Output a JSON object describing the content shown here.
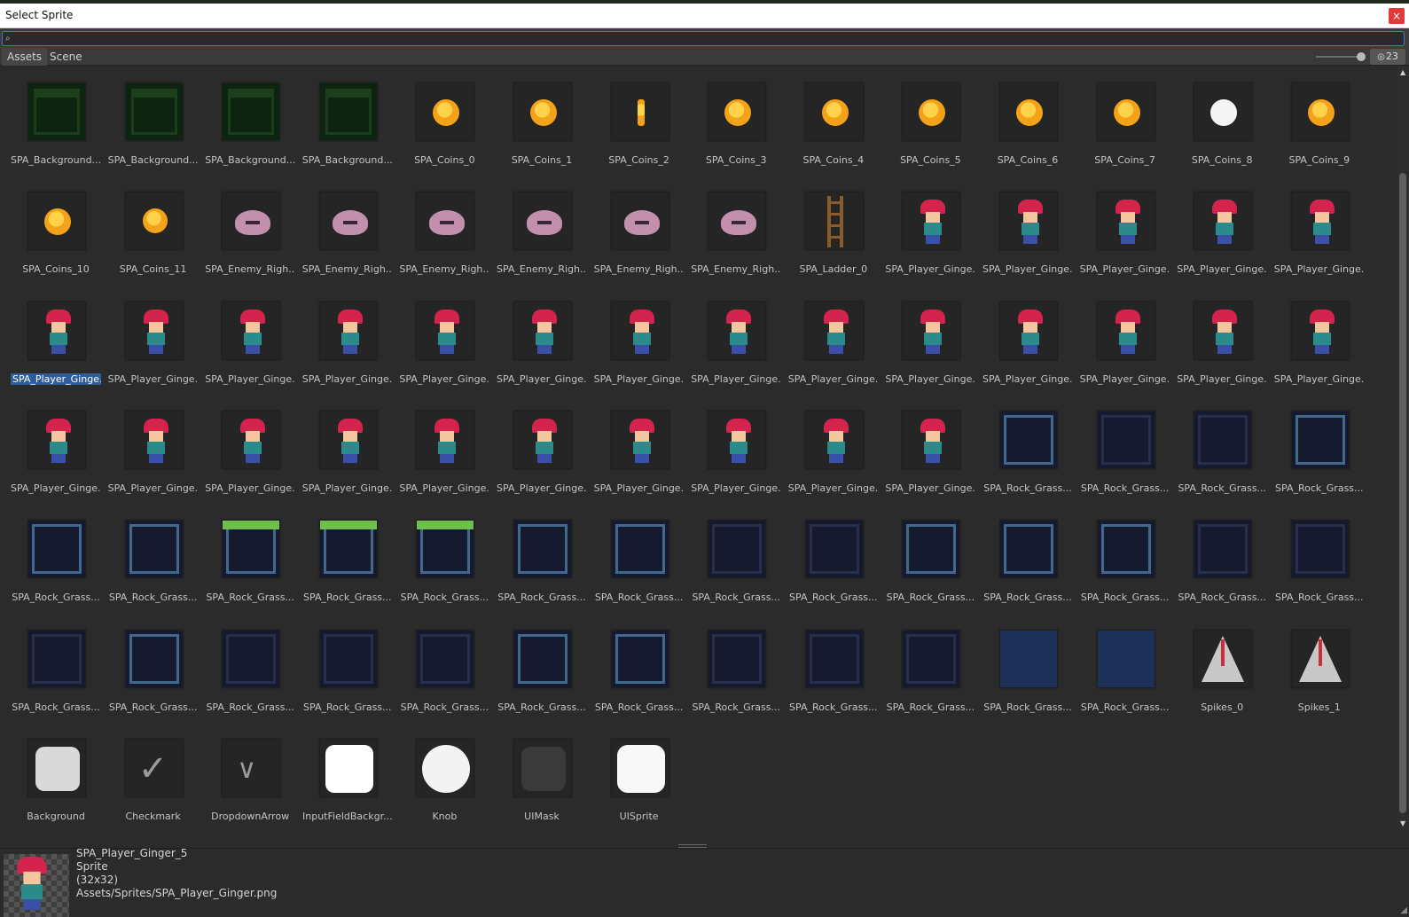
{
  "window": {
    "title": "Select Sprite",
    "close_glyph": "×"
  },
  "search": {
    "value": "",
    "placeholder": ""
  },
  "tabs": [
    {
      "label": "Assets",
      "active": true
    },
    {
      "label": "Scene",
      "active": false
    }
  ],
  "toolbar": {
    "hidden_count": "23"
  },
  "colors": {
    "selection": "#2f5d9a",
    "search_focus": "#3d7ad8",
    "close": "#e13a3a"
  },
  "items": [
    {
      "label": "SPA_Background...",
      "kind": "bg"
    },
    {
      "label": "SPA_Background...",
      "kind": "bg"
    },
    {
      "label": "SPA_Background...",
      "kind": "bg"
    },
    {
      "label": "SPA_Background...",
      "kind": "bg"
    },
    {
      "label": "SPA_Coins_0",
      "kind": "coin"
    },
    {
      "label": "SPA_Coins_1",
      "kind": "coin"
    },
    {
      "label": "SPA_Coins_2",
      "kind": "coin-thin"
    },
    {
      "label": "SPA_Coins_3",
      "kind": "coin"
    },
    {
      "label": "SPA_Coins_4",
      "kind": "coin"
    },
    {
      "label": "SPA_Coins_5",
      "kind": "coin"
    },
    {
      "label": "SPA_Coins_6",
      "kind": "coin"
    },
    {
      "label": "SPA_Coins_7",
      "kind": "coin"
    },
    {
      "label": "SPA_Coins_8",
      "kind": "coin-white"
    },
    {
      "label": "SPA_Coins_9",
      "kind": "coin"
    },
    {
      "label": "SPA_Coins_10",
      "kind": "coin"
    },
    {
      "label": "SPA_Coins_11",
      "kind": "coin-small"
    },
    {
      "label": "SPA_Enemy_Righ...",
      "kind": "enemy"
    },
    {
      "label": "SPA_Enemy_Righ...",
      "kind": "enemy"
    },
    {
      "label": "SPA_Enemy_Righ...",
      "kind": "enemy"
    },
    {
      "label": "SPA_Enemy_Righ...",
      "kind": "enemy"
    },
    {
      "label": "SPA_Enemy_Righ...",
      "kind": "enemy"
    },
    {
      "label": "SPA_Enemy_Righ...",
      "kind": "enemy"
    },
    {
      "label": "SPA_Ladder_0",
      "kind": "ladder"
    },
    {
      "label": "SPA_Player_Ginge...",
      "kind": "player"
    },
    {
      "label": "SPA_Player_Ginge...",
      "kind": "player"
    },
    {
      "label": "SPA_Player_Ginge...",
      "kind": "player"
    },
    {
      "label": "SPA_Player_Ginge...",
      "kind": "player"
    },
    {
      "label": "SPA_Player_Ginge...",
      "kind": "player"
    },
    {
      "label": "SPA_Player_Ginge...",
      "kind": "player",
      "selected": true
    },
    {
      "label": "SPA_Player_Ginge...",
      "kind": "player"
    },
    {
      "label": "SPA_Player_Ginge...",
      "kind": "player"
    },
    {
      "label": "SPA_Player_Ginge...",
      "kind": "player"
    },
    {
      "label": "SPA_Player_Ginge...",
      "kind": "player"
    },
    {
      "label": "SPA_Player_Ginge...",
      "kind": "player"
    },
    {
      "label": "SPA_Player_Ginge...",
      "kind": "player"
    },
    {
      "label": "SPA_Player_Ginge...",
      "kind": "player"
    },
    {
      "label": "SPA_Player_Ginge...",
      "kind": "player"
    },
    {
      "label": "SPA_Player_Ginge...",
      "kind": "player"
    },
    {
      "label": "SPA_Player_Ginge...",
      "kind": "player"
    },
    {
      "label": "SPA_Player_Ginge...",
      "kind": "player"
    },
    {
      "label": "SPA_Player_Ginge...",
      "kind": "player"
    },
    {
      "label": "SPA_Player_Ginge...",
      "kind": "player"
    },
    {
      "label": "SPA_Player_Ginge...",
      "kind": "player"
    },
    {
      "label": "SPA_Player_Ginge...",
      "kind": "player"
    },
    {
      "label": "SPA_Player_Ginge...",
      "kind": "player"
    },
    {
      "label": "SPA_Player_Ginge...",
      "kind": "player"
    },
    {
      "label": "SPA_Player_Ginge...",
      "kind": "player"
    },
    {
      "label": "SPA_Player_Ginge...",
      "kind": "player"
    },
    {
      "label": "SPA_Player_Ginge...",
      "kind": "player"
    },
    {
      "label": "SPA_Player_Ginge...",
      "kind": "player"
    },
    {
      "label": "SPA_Player_Ginge...",
      "kind": "player"
    },
    {
      "label": "SPA_Player_Ginge...",
      "kind": "player"
    },
    {
      "label": "SPA_Rock_Grass...",
      "kind": "rock"
    },
    {
      "label": "SPA_Rock_Grass...",
      "kind": "rock-dark"
    },
    {
      "label": "SPA_Rock_Grass...",
      "kind": "rock-dark"
    },
    {
      "label": "SPA_Rock_Grass...",
      "kind": "rock"
    },
    {
      "label": "SPA_Rock_Grass...",
      "kind": "rock"
    },
    {
      "label": "SPA_Rock_Grass...",
      "kind": "rock"
    },
    {
      "label": "SPA_Rock_Grass...",
      "kind": "rock-grass"
    },
    {
      "label": "SPA_Rock_Grass...",
      "kind": "rock-grass"
    },
    {
      "label": "SPA_Rock_Grass...",
      "kind": "rock-grass"
    },
    {
      "label": "SPA_Rock_Grass...",
      "kind": "rock"
    },
    {
      "label": "SPA_Rock_Grass...",
      "kind": "rock"
    },
    {
      "label": "SPA_Rock_Grass...",
      "kind": "rock-dark"
    },
    {
      "label": "SPA_Rock_Grass...",
      "kind": "rock-dark"
    },
    {
      "label": "SPA_Rock_Grass...",
      "kind": "rock"
    },
    {
      "label": "SPA_Rock_Grass...",
      "kind": "rock"
    },
    {
      "label": "SPA_Rock_Grass...",
      "kind": "rock"
    },
    {
      "label": "SPA_Rock_Grass...",
      "kind": "rock-dark"
    },
    {
      "label": "SPA_Rock_Grass...",
      "kind": "rock-dark"
    },
    {
      "label": "SPA_Rock_Grass...",
      "kind": "rock-dark"
    },
    {
      "label": "SPA_Rock_Grass...",
      "kind": "rock"
    },
    {
      "label": "SPA_Rock_Grass...",
      "kind": "rock-dark"
    },
    {
      "label": "SPA_Rock_Grass...",
      "kind": "rock-dark"
    },
    {
      "label": "SPA_Rock_Grass...",
      "kind": "rock-dark"
    },
    {
      "label": "SPA_Rock_Grass...",
      "kind": "rock"
    },
    {
      "label": "SPA_Rock_Grass...",
      "kind": "rock"
    },
    {
      "label": "SPA_Rock_Grass...",
      "kind": "rock-dark"
    },
    {
      "label": "SPA_Rock_Grass...",
      "kind": "rock-dark"
    },
    {
      "label": "SPA_Rock_Grass...",
      "kind": "rock-dark"
    },
    {
      "label": "SPA_Rock_Grass...",
      "kind": "rock-blue"
    },
    {
      "label": "SPA_Rock_Grass...",
      "kind": "rock-blue"
    },
    {
      "label": "Spikes_0",
      "kind": "spike"
    },
    {
      "label": "Spikes_1",
      "kind": "spike"
    },
    {
      "label": "Background",
      "kind": "ui-bg"
    },
    {
      "label": "Checkmark",
      "kind": "ui-check"
    },
    {
      "label": "DropdownArrow",
      "kind": "ui-arrow"
    },
    {
      "label": "InputFieldBackgr...",
      "kind": "ui-input"
    },
    {
      "label": "Knob",
      "kind": "ui-knob"
    },
    {
      "label": "UIMask",
      "kind": "ui-mask"
    },
    {
      "label": "UISprite",
      "kind": "ui-sprite"
    }
  ],
  "details": {
    "name": "SPA_Player_Ginger_5",
    "type": "Sprite",
    "size": "(32x32)",
    "path": "Assets/Sprites/SPA_Player_Ginger.png"
  },
  "icons": {
    "search": "search-icon",
    "eye": "eye-slash-icon",
    "close": "close-icon"
  }
}
